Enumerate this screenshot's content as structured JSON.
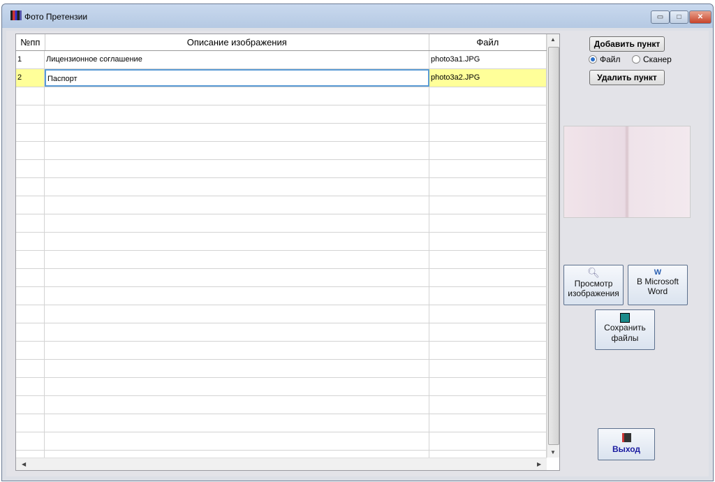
{
  "window": {
    "title": "Фото Претензии",
    "minimize": "▭",
    "maximize": "□",
    "close": "✕"
  },
  "table": {
    "headers": [
      "№пп",
      "Описание изображения",
      "Файл"
    ],
    "rows": [
      {
        "num": "1",
        "desc": "Лицензионное соглашение",
        "file": "photo3a1.JPG"
      },
      {
        "num": "2",
        "desc": "Паспорт",
        "file": "photo3a2.JPG"
      }
    ],
    "selected_row": 2
  },
  "buttons": {
    "add": "Добавить пункт",
    "delete": "Удалить пункт",
    "view": "Просмотр изображения",
    "word": "В Microsoft Word",
    "save": "Сохранить файлы",
    "exit": "Выход"
  },
  "source": {
    "file": "Файл",
    "scanner": "Сканер",
    "selected": "file"
  },
  "colors": {
    "selected_row": "#ffff99",
    "exit_text": "#1a1aa0"
  }
}
